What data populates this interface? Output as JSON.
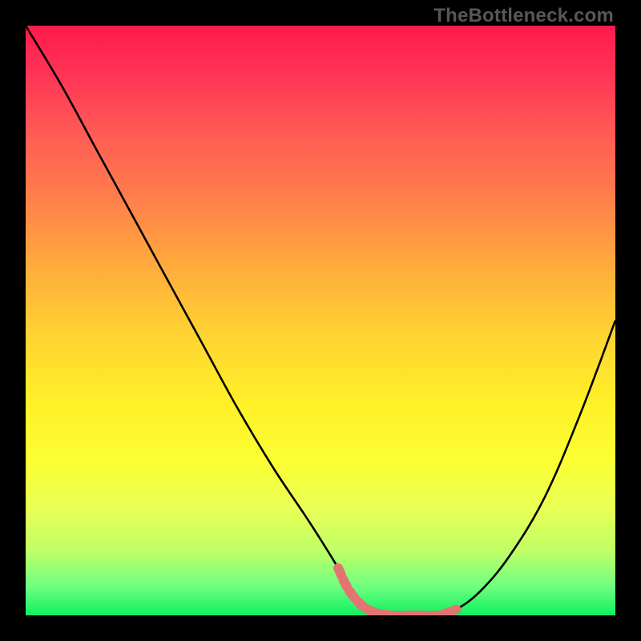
{
  "watermark": "TheBottleneck.com",
  "chart_data": {
    "type": "line",
    "title": "",
    "xlabel": "",
    "ylabel": "",
    "xlim": [
      0,
      100
    ],
    "ylim": [
      0,
      100
    ],
    "series": [
      {
        "name": "bottleneck-curve",
        "color": "#000000",
        "x": [
          0,
          6,
          12,
          18,
          24,
          30,
          36,
          42,
          48,
          53,
          55,
          58,
          62,
          66,
          70,
          73,
          77,
          82,
          88,
          94,
          100
        ],
        "y": [
          100,
          90,
          79,
          68,
          57,
          46,
          35,
          25,
          16,
          8,
          4,
          1,
          0,
          0,
          0,
          1,
          4,
          10,
          20,
          34,
          50
        ]
      },
      {
        "name": "highlight-band",
        "color": "#e37472",
        "x": [
          53,
          55,
          58,
          62,
          66,
          70,
          73
        ],
        "y": [
          8,
          4,
          1,
          0,
          0,
          0,
          1
        ]
      }
    ]
  }
}
